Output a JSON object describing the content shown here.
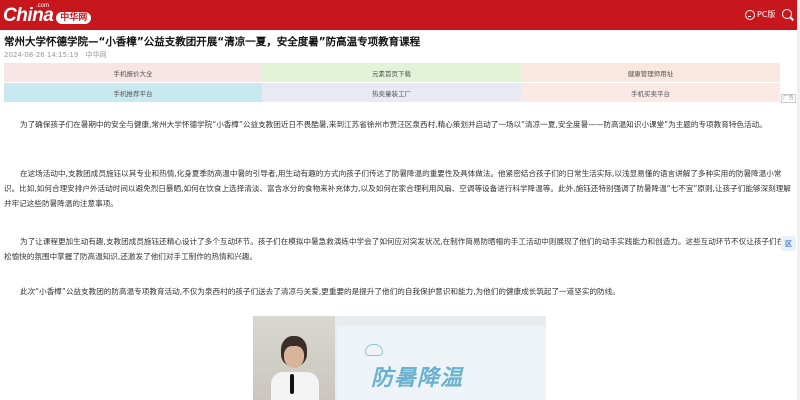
{
  "header": {
    "logo_text": "China",
    "logo_dot": ".com",
    "logo_badge": "中华网",
    "pc_label": "PC版"
  },
  "article": {
    "title": "常州大学怀德学院—“小香樟”公益支教团开展“清凉一夏，安全度暑”防高温专项教育课程",
    "date": "2024-08-26 14:15:19",
    "source": "中华网",
    "paragraphs": [
      "为了确保孩子们在暑期中的安全与健康,常州大学怀德学院“小香樟”公益支教团近日不畏酷暑,来到江苏省徐州市贾汪区泉西村,精心策划并启动了一场以“清凉一夏,安全度暑——防高温知识小课堂”为主题的专项教育特色活动。",
      "在这场活动中,支教团成员施钰以其专业和热情,化身夏季防高温中暑的引导者,用生动有趣的方式向孩子们传达了防暑降温的重要性及具体做法。他紧密结合孩子们的日常生活实际,以浅显易懂的语言讲解了多种实用的防暑降温小常识。比如,如何合理安排户外活动时间以避免烈日暴晒,如何在饮食上选择清淡、富含水分的食物来补充体力,以及如何在家合理利用风扇、空调等设备进行科学降温等。此外,施钰还特别强调了防暑降温“七不宜”原则,让孩子们能够深刻理解并牢记这些防暑降温的注意事项。",
      "为了让课程更加生动有趣,支教团成员施钰还精心设计了多个互动环节。孩子们在模拟中暑急救演练中学会了如何应对突发状况,在制作简易防晒帽的手工活动中则展现了他们的动手实践能力和创造力。这些互动环节不仅让孩子们在轻松愉快的氛围中掌握了防高温知识,还激发了他们对手工制作的热情和兴趣。",
      "此次“小香樟”公益支教团的防高温专项教育活动,不仅为泉西村的孩子们送去了清凉与关爱,更重要的是提升了他们的自我保护意识和能力,为他们的健康成长筑起了一道坚实的防线。"
    ]
  },
  "links": [
    {
      "label": "手机报价大全",
      "bg": "#f7e4e4"
    },
    {
      "label": "元素首页下载",
      "bg": "#e3f3d7"
    },
    {
      "label": "健康管理师用址",
      "bg": "#f9e8df"
    },
    {
      "label": "手机推荐平台",
      "bg": "#c9e9f1"
    },
    {
      "label": "热卖童装工厂",
      "bg": "#e9e9f3"
    },
    {
      "label": "手机买卖平台",
      "bg": "#fae9e5"
    }
  ],
  "ad_badge": "广告",
  "photo": {
    "screen_text": "防暑降温"
  },
  "side_widget_label": "区"
}
